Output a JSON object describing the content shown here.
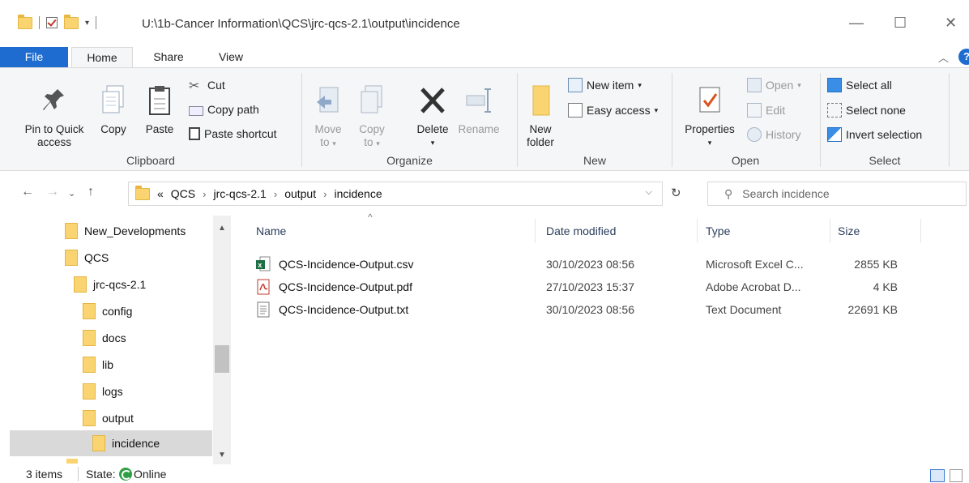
{
  "window": {
    "title_path": "U:\\1b-Cancer Information\\QCS\\jrc-qcs-2.1\\output\\incidence",
    "minimize": "—",
    "maximize": "☐",
    "close": "✕"
  },
  "ribbon_tabs": [
    "File",
    "Home",
    "Share",
    "View"
  ],
  "ribbon": {
    "clipboard": {
      "label": "Clipboard",
      "pin": "Pin to Quick access",
      "pin_l1": "Pin to Quick",
      "pin_l2": "access",
      "copy": "Copy",
      "paste": "Paste",
      "cut": "Cut",
      "copy_path": "Copy path",
      "paste_shortcut": "Paste shortcut"
    },
    "organize": {
      "label": "Organize",
      "move_to_l1": "Move",
      "move_to_l2": "to",
      "copy_to_l1": "Copy",
      "copy_to_l2": "to",
      "delete": "Delete",
      "rename": "Rename"
    },
    "new": {
      "label": "New",
      "new_folder_l1": "New",
      "new_folder_l2": "folder",
      "new_item": "New item",
      "easy_access": "Easy access"
    },
    "open": {
      "label": "Open",
      "properties": "Properties",
      "open": "Open",
      "edit": "Edit",
      "history": "History"
    },
    "select": {
      "label": "Select",
      "select_all": "Select all",
      "select_none": "Select none",
      "invert_selection": "Invert selection"
    }
  },
  "address": {
    "prefix": "«",
    "crumbs": [
      "QCS",
      "jrc-qcs-2.1",
      "output",
      "incidence"
    ],
    "search_placeholder": "Search incidence"
  },
  "nav_tree": [
    {
      "label": "New_Developments",
      "indent": 0
    },
    {
      "label": "QCS",
      "indent": 0
    },
    {
      "label": "jrc-qcs-2.1",
      "indent": 1
    },
    {
      "label": "config",
      "indent": 2
    },
    {
      "label": "docs",
      "indent": 2
    },
    {
      "label": "lib",
      "indent": 2
    },
    {
      "label": "logs",
      "indent": 2
    },
    {
      "label": "output",
      "indent": 2
    },
    {
      "label": "incidence",
      "indent": 3
    }
  ],
  "columns": {
    "name": "Name",
    "date": "Date modified",
    "type": "Type",
    "size": "Size"
  },
  "files": [
    {
      "name": "QCS-Incidence-Output.csv",
      "date": "30/10/2023 08:56",
      "type": "Microsoft Excel C...",
      "size": "2855 KB",
      "icon": "excel-csv-icon"
    },
    {
      "name": "QCS-Incidence-Output.pdf",
      "date": "27/10/2023 15:37",
      "type": "Adobe Acrobat D...",
      "size": "4 KB",
      "icon": "pdf-icon"
    },
    {
      "name": "QCS-Incidence-Output.txt",
      "date": "30/10/2023 08:56",
      "type": "Text Document",
      "size": "22691 KB",
      "icon": "text-file-icon"
    }
  ],
  "status": {
    "items": "3 items",
    "state_label": "State:",
    "state_value": "Online"
  }
}
